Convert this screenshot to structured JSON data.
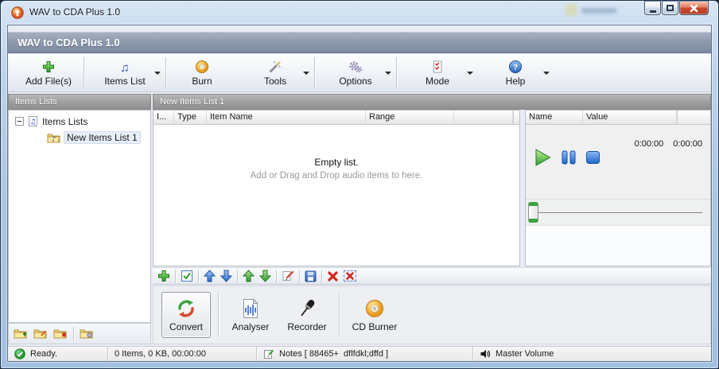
{
  "window": {
    "title": "WAV to CDA Plus 1.0",
    "controls": {
      "minimize": "minimize-button",
      "maximize": "maximize-button",
      "close": "close-button"
    }
  },
  "app_header": {
    "title": "WAV to CDA Plus 1.0"
  },
  "toolbar": {
    "items": [
      {
        "label": "Add File(s)",
        "icon": "add-file-icon",
        "dropdown": false
      },
      {
        "label": "Items List",
        "icon": "music-notes-icon",
        "dropdown": true
      },
      {
        "label": "Burn",
        "icon": "burn-disc-icon",
        "dropdown": false
      },
      {
        "label": "Tools",
        "icon": "magic-wand-icon",
        "dropdown": true
      },
      {
        "label": "Options",
        "icon": "gears-icon",
        "dropdown": true
      },
      {
        "label": "Mode",
        "icon": "checklist-icon",
        "dropdown": true
      },
      {
        "label": "Help",
        "icon": "help-icon",
        "dropdown": true
      }
    ]
  },
  "left_panel": {
    "header": "Items Lists",
    "tree": {
      "root": "Items Lists",
      "child": "New Items List 1"
    },
    "footer_icons": [
      "add-list-icon",
      "edit-list-icon",
      "delete-list-icon",
      "list-settings-icon"
    ]
  },
  "items_panel": {
    "header": "New Items List 1",
    "columns": [
      "I...",
      "Type",
      "Item Name",
      "Range",
      ""
    ],
    "empty_title": "Empty list.",
    "empty_subtitle": "Add or Drag and Drop audio items to here."
  },
  "properties_panel": {
    "columns": [
      "Name",
      "Value"
    ],
    "player": {
      "elapsed": "0:00:00",
      "total": "0:00:00",
      "icons": [
        "play-icon",
        "pause-icon",
        "stop-icon"
      ]
    }
  },
  "list_toolbar": {
    "icons": [
      "add-item-icon",
      "check-items-icon",
      "move-up-icon",
      "move-down-icon",
      "sort-up-icon",
      "sort-down-icon",
      "edit-item-icon",
      "save-list-icon",
      "delete-item-icon",
      "delete-all-icon"
    ]
  },
  "launcher_panel": {
    "buttons": [
      {
        "label": "Convert",
        "icon": "convert-icon",
        "selected": true
      },
      {
        "label": "Analyser",
        "icon": "analyser-icon",
        "selected": false
      },
      {
        "label": "Recorder",
        "icon": "recorder-icon",
        "selected": false
      },
      {
        "label": "CD Burner",
        "icon": "cd-burner-icon",
        "selected": false
      }
    ]
  },
  "status_bar": {
    "ready": "Ready.",
    "items_info": "0 Items, 0 KB, 00:00:00",
    "notes": "Notes [ 88465+  dflfdkl;dffd ]",
    "volume": "Master Volume"
  },
  "colors": {
    "close_button": "#c9452b",
    "header_band": "#8d98ac",
    "panel_header": "#9f9f9f",
    "play_green": "#3fa23f",
    "control_blue": "#2a6cd0",
    "accent_orange": "#efa126"
  }
}
